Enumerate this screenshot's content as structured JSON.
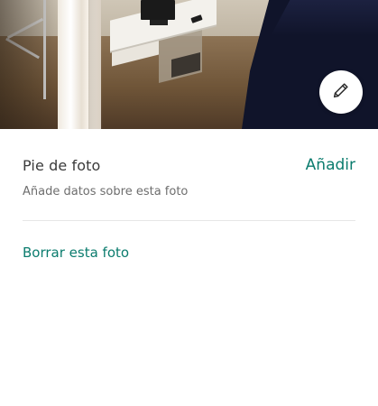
{
  "photo": {
    "edit_icon": "pencil-icon"
  },
  "caption": {
    "title": "Pie de foto",
    "add_label": "Añadir",
    "helper": "Añade datos sobre esta foto"
  },
  "actions": {
    "delete_label": "Borrar esta foto"
  },
  "colors": {
    "accent": "#0b7c6e",
    "text_primary": "#3b3b3b",
    "text_secondary": "#6e6e6e",
    "divider": "#e6e6e6"
  }
}
